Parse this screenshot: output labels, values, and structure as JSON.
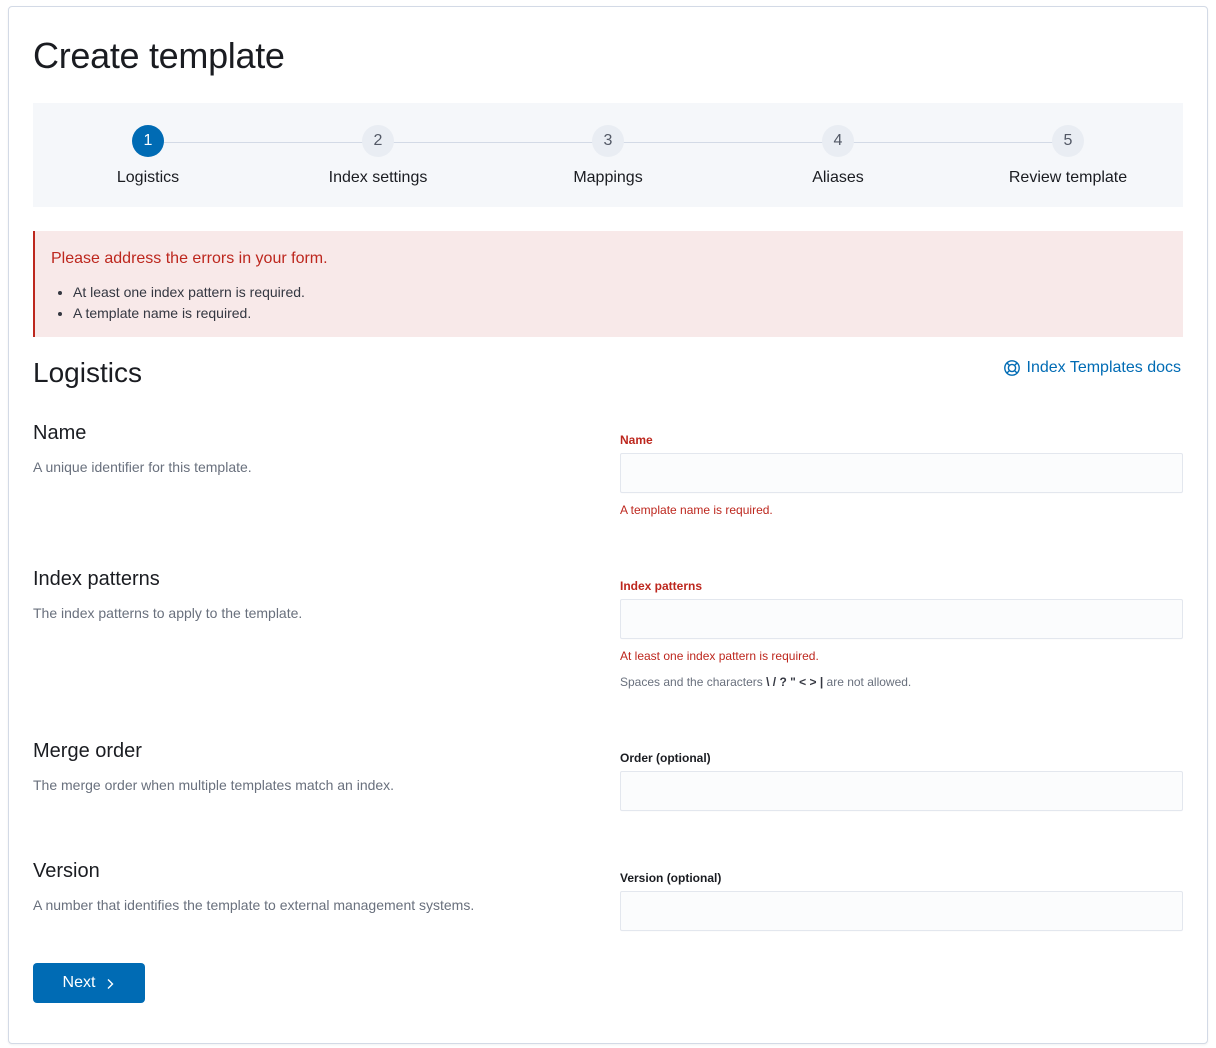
{
  "page": {
    "title": "Create template"
  },
  "steps": [
    {
      "number": "1",
      "label": "Logistics",
      "active": true
    },
    {
      "number": "2",
      "label": "Index settings",
      "active": false
    },
    {
      "number": "3",
      "label": "Mappings",
      "active": false
    },
    {
      "number": "4",
      "label": "Aliases",
      "active": false
    },
    {
      "number": "5",
      "label": "Review template",
      "active": false
    }
  ],
  "callout": {
    "title": "Please address the errors in your form.",
    "items": [
      "At least one index pattern is required.",
      "A template name is required."
    ]
  },
  "section": {
    "title": "Logistics",
    "docs_link": "Index Templates docs",
    "docs_icon": "lifebuoy-icon"
  },
  "fields": {
    "name": {
      "title": "Name",
      "description": "A unique identifier for this template.",
      "label": "Name",
      "value": "",
      "error": "A template name is required."
    },
    "index_patterns": {
      "title": "Index patterns",
      "description": "The index patterns to apply to the template.",
      "label": "Index patterns",
      "value": "",
      "error": "At least one index pattern is required.",
      "help_prefix": "Spaces and the characters",
      "help_chars": "\\ / ? \" < > |",
      "help_suffix": "are not allowed."
    },
    "order": {
      "title": "Merge order",
      "description": "The merge order when multiple templates match an index.",
      "label": "Order (optional)",
      "value": ""
    },
    "version": {
      "title": "Version",
      "description": "A number that identifies the template to external management systems.",
      "label": "Version (optional)",
      "value": ""
    }
  },
  "actions": {
    "next_label": "Next"
  },
  "colors": {
    "primary": "#006bb4",
    "danger": "#bd271e",
    "callout_bg": "#f8e9e9",
    "steps_bg": "#f5f7fa"
  }
}
